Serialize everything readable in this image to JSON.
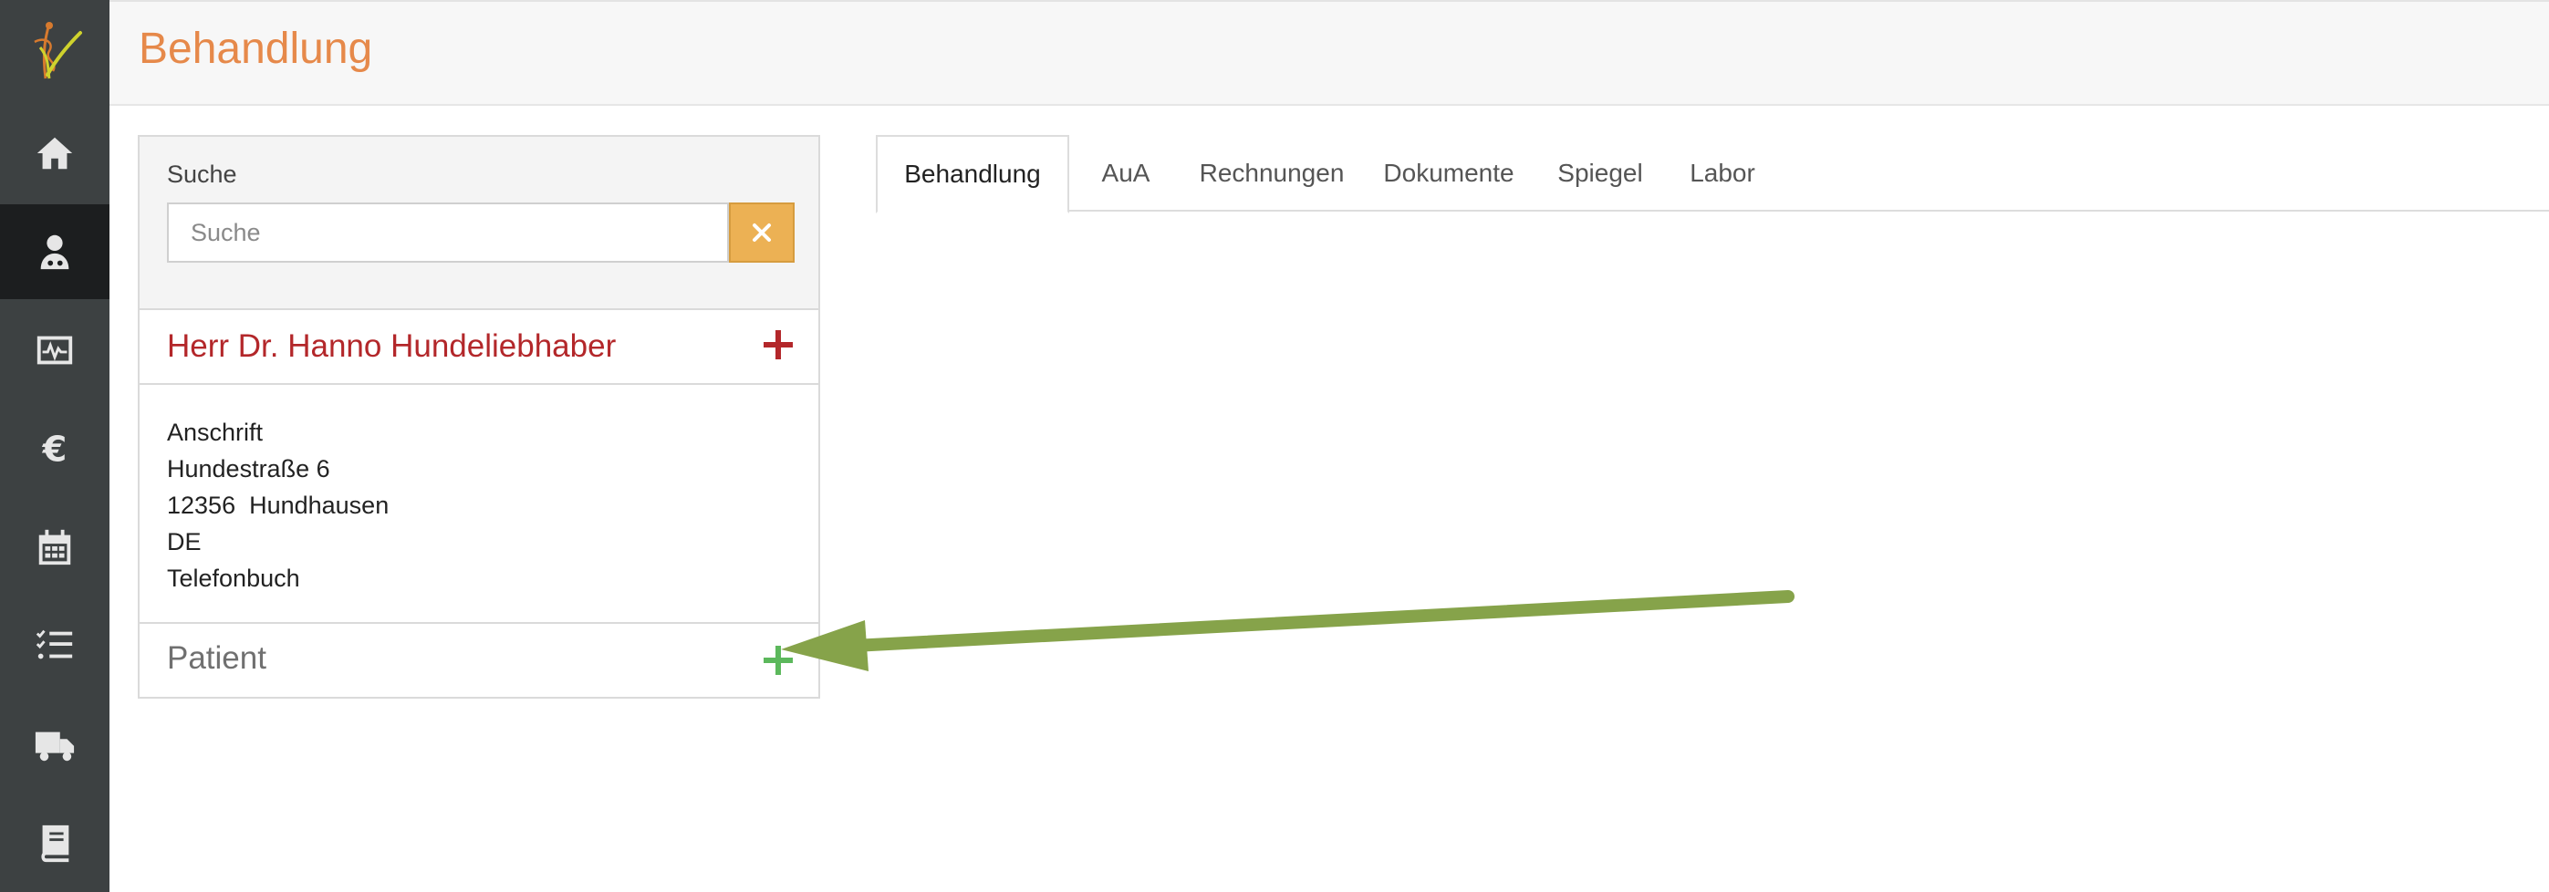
{
  "header": {
    "title": "Behandlung"
  },
  "sidebar": {
    "logo_icon": "caduceus-logo-icon",
    "items": [
      {
        "icon": "home-icon",
        "active": false
      },
      {
        "icon": "user-doctor-icon",
        "active": true
      },
      {
        "icon": "monitor-chart-icon",
        "active": false
      },
      {
        "icon": "euro-icon",
        "active": false
      },
      {
        "icon": "calendar-icon",
        "active": false
      },
      {
        "icon": "checklist-icon",
        "active": false
      },
      {
        "icon": "truck-icon",
        "active": false
      },
      {
        "icon": "book-icon",
        "active": false
      }
    ]
  },
  "search": {
    "label": "Suche",
    "placeholder": "Suche",
    "value": "",
    "clear_icon": "close-icon"
  },
  "owner": {
    "name": "Herr Dr. Hanno Hundeliebhaber",
    "add_icon": "plus-icon"
  },
  "address": {
    "heading": "Anschrift",
    "street": "Hundestraße 6",
    "city_line": "12356  Hundhausen",
    "country": "DE",
    "phone_label": "Telefonbuch"
  },
  "patient": {
    "label": "Patient",
    "add_icon": "plus-icon"
  },
  "tabs": [
    {
      "label": "Behandlung",
      "active": true
    },
    {
      "label": "AuA",
      "active": false
    },
    {
      "label": "Rechnungen",
      "active": false
    },
    {
      "label": "Dokumente",
      "active": false
    },
    {
      "label": "Spiegel",
      "active": false
    },
    {
      "label": "Labor",
      "active": false
    }
  ],
  "colors": {
    "sidebar_bg": "#3d4142",
    "sidebar_active_bg": "#1c1e1f",
    "title_orange": "#e6894a",
    "owner_red": "#b3272a",
    "patient_plus_green": "#5cb85c",
    "clear_button_orange": "#ecb154",
    "annotation_arrow": "#86a34a"
  }
}
